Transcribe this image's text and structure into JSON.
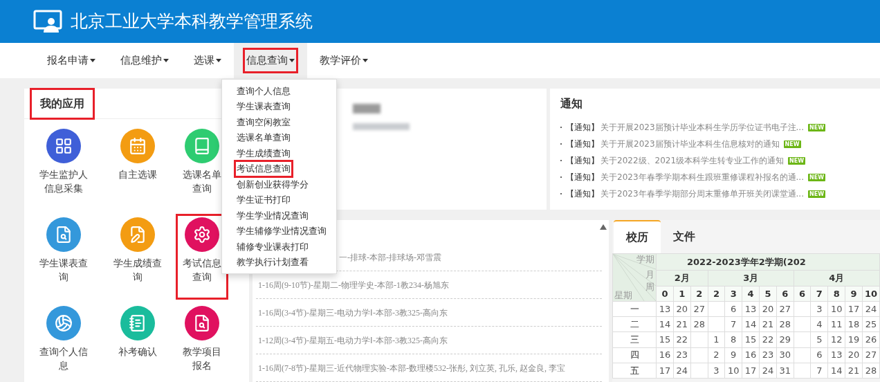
{
  "header": {
    "title": "北京工业大学本科教学管理系统"
  },
  "nav": [
    {
      "label": "报名申请",
      "selected": false,
      "highlighted": false
    },
    {
      "label": "信息维护",
      "selected": false,
      "highlighted": false
    },
    {
      "label": "选课",
      "selected": false,
      "highlighted": false
    },
    {
      "label": "信息查询",
      "selected": true,
      "highlighted": true
    },
    {
      "label": "教学评价",
      "selected": false,
      "highlighted": false
    }
  ],
  "dropdown": {
    "items": [
      {
        "label": "查询个人信息",
        "highlighted": false
      },
      {
        "label": "学生课表查询",
        "highlighted": false
      },
      {
        "label": "查询空闲教室",
        "highlighted": false
      },
      {
        "label": "选课名单查询",
        "highlighted": false
      },
      {
        "label": "学生成绩查询",
        "highlighted": false
      },
      {
        "label": "考试信息查询",
        "highlighted": true
      },
      {
        "label": "创新创业获得学分",
        "highlighted": false
      },
      {
        "label": "学生证书打印",
        "highlighted": false
      },
      {
        "label": "学生学业情况查询",
        "highlighted": false
      },
      {
        "label": "学生辅修学业情况查询",
        "highlighted": false
      },
      {
        "label": "辅修专业课表打印",
        "highlighted": false
      },
      {
        "label": "教学执行计划查看",
        "highlighted": false
      }
    ]
  },
  "my_apps": {
    "title": "我的应用",
    "highlighted": true,
    "apps": [
      {
        "label": "学生监护人信息采集",
        "kind": "grid",
        "color": "#3f5fd8",
        "highlighted": false
      },
      {
        "label": "自主选课",
        "kind": "calendar",
        "color": "#f39c12",
        "highlighted": false
      },
      {
        "label": "选课名单查询",
        "kind": "book",
        "color": "#2ecc71",
        "highlighted": false
      },
      {
        "label": "学生课表查询",
        "kind": "search-doc",
        "color": "#3498db",
        "highlighted": false
      },
      {
        "label": "学生成绩查询",
        "kind": "edit",
        "color": "#f39c12",
        "highlighted": false
      },
      {
        "label": "考试信息查询",
        "kind": "gear",
        "color": "#e0115f",
        "highlighted": true
      },
      {
        "label": "查询个人信息",
        "kind": "ball",
        "color": "#3498db",
        "highlighted": false
      },
      {
        "label": "补考确认",
        "kind": "notebook",
        "color": "#1abc9c",
        "highlighted": false
      },
      {
        "label": "教学项目报名",
        "kind": "search-doc",
        "color": "#e0115f",
        "highlighted": false
      }
    ]
  },
  "notices": {
    "title": "通知",
    "items": [
      {
        "tag": "【通知】",
        "text": "关于开展2023届预计毕业本科生学历学位证书电子注...",
        "badge": "NEW"
      },
      {
        "tag": "【通知】",
        "text": "关于开展2023届预计毕业本科生信息核对的通知",
        "badge": "NEW"
      },
      {
        "tag": "【通知】",
        "text": "关于2022级、2021级本科学生转专业工作的通知",
        "badge": "NEW"
      },
      {
        "tag": "【通知】",
        "text": "关于2023年春季学期本科生跟班重修课程补报名的通...",
        "badge": "NEW"
      },
      {
        "tag": "【通知】",
        "text": "关于2023年春季学期部分周末重修单开班关闭课堂通...",
        "badge": "NEW"
      }
    ]
  },
  "courses": {
    "rows": [
      "一-排球-本部-排球场-邓雪震",
      "1-16周(9-10节)-星期二-物理学史-本部-1教234-杨旭东",
      "1-16周(3-4节)-星期三-电动力学Ⅰ-本部-3教325-高向东",
      "1-12周(3-4节)-星期五-电动力学Ⅰ-本部-3教325-高向东",
      "1-16周(7-8节)-星期三-近代物理实验-本部-数理楼532-张彤, 刘立英, 孔乐, 赵金良, 李宝"
    ]
  },
  "calendar": {
    "tabs": [
      {
        "label": "校历",
        "selected": true
      },
      {
        "label": "文件",
        "selected": false
      }
    ],
    "corner": {
      "term": "学期",
      "month": "月",
      "week": "周",
      "weekday": "星期"
    },
    "term": "2022-2023学年2学期(202",
    "months": [
      {
        "label": "2月",
        "weeks": [
          "0",
          "1",
          "2"
        ]
      },
      {
        "label": "3月",
        "weeks": [
          "2",
          "3",
          "4",
          "5",
          "6"
        ]
      },
      {
        "label": "4月",
        "weeks": [
          "6",
          "7",
          "8",
          "9",
          "10"
        ]
      }
    ],
    "rows": [
      {
        "day": "一",
        "cells": [
          {
            "kind": "date",
            "date": "13"
          },
          {
            "kind": "date",
            "date": "20"
          },
          {
            "kind": "date",
            "date": "27"
          },
          {
            "kind": "empty"
          },
          {
            "kind": "date",
            "date": "6"
          },
          {
            "kind": "date",
            "date": "13"
          },
          {
            "kind": "date",
            "date": "20"
          },
          {
            "kind": "date",
            "date": "27"
          },
          {
            "kind": "empty"
          },
          {
            "kind": "date",
            "date": "3"
          },
          {
            "kind": "date",
            "date": "10"
          },
          {
            "kind": "date",
            "date": "17"
          },
          {
            "kind": "date",
            "date": "24"
          }
        ]
      },
      {
        "day": "二",
        "cells": [
          {
            "kind": "date",
            "date": "14"
          },
          {
            "kind": "date",
            "date": "21"
          },
          {
            "kind": "date",
            "date": "28"
          },
          {
            "kind": "empty"
          },
          {
            "kind": "date",
            "date": "7"
          },
          {
            "kind": "date",
            "date": "14"
          },
          {
            "kind": "date",
            "date": "21"
          },
          {
            "kind": "date",
            "date": "28"
          },
          {
            "kind": "empty"
          },
          {
            "kind": "date",
            "date": "4"
          },
          {
            "kind": "date",
            "date": "11"
          },
          {
            "kind": "date",
            "date": "18"
          },
          {
            "kind": "date",
            "date": "25"
          }
        ]
      },
      {
        "day": "三",
        "cells": [
          {
            "kind": "date",
            "date": "15"
          },
          {
            "kind": "date",
            "date": "22"
          },
          {
            "kind": "empty"
          },
          {
            "kind": "date",
            "date": "1"
          },
          {
            "kind": "date",
            "date": "8"
          },
          {
            "kind": "date",
            "date": "15"
          },
          {
            "kind": "date",
            "date": "22"
          },
          {
            "kind": "date",
            "date": "29"
          },
          {
            "kind": "empty"
          },
          {
            "kind": "date",
            "date": "5"
          },
          {
            "kind": "date",
            "date": "12"
          },
          {
            "kind": "date",
            "date": "19"
          },
          {
            "kind": "date",
            "date": "26"
          }
        ]
      },
      {
        "day": "四",
        "cells": [
          {
            "kind": "date",
            "date": "16"
          },
          {
            "kind": "date",
            "date": "23"
          },
          {
            "kind": "empty"
          },
          {
            "kind": "date",
            "date": "2"
          },
          {
            "kind": "date",
            "date": "9"
          },
          {
            "kind": "date",
            "date": "16"
          },
          {
            "kind": "date",
            "date": "23"
          },
          {
            "kind": "date",
            "date": "30"
          },
          {
            "kind": "empty"
          },
          {
            "kind": "date",
            "date": "6"
          },
          {
            "kind": "date",
            "date": "13"
          },
          {
            "kind": "date",
            "date": "20"
          },
          {
            "kind": "date",
            "date": "27"
          }
        ]
      },
      {
        "day": "五",
        "cells": [
          {
            "kind": "date",
            "date": "17"
          },
          {
            "kind": "date",
            "date": "24"
          },
          {
            "kind": "empty"
          },
          {
            "kind": "date",
            "date": "3"
          },
          {
            "kind": "date",
            "date": "10"
          },
          {
            "kind": "date",
            "date": "17"
          },
          {
            "kind": "date",
            "date": "24"
          },
          {
            "kind": "date",
            "date": "31"
          },
          {
            "kind": "empty"
          },
          {
            "kind": "date",
            "date": "7"
          },
          {
            "kind": "date",
            "date": "14"
          },
          {
            "kind": "date",
            "date": "21"
          },
          {
            "kind": "date",
            "date": "28"
          }
        ]
      }
    ]
  }
}
